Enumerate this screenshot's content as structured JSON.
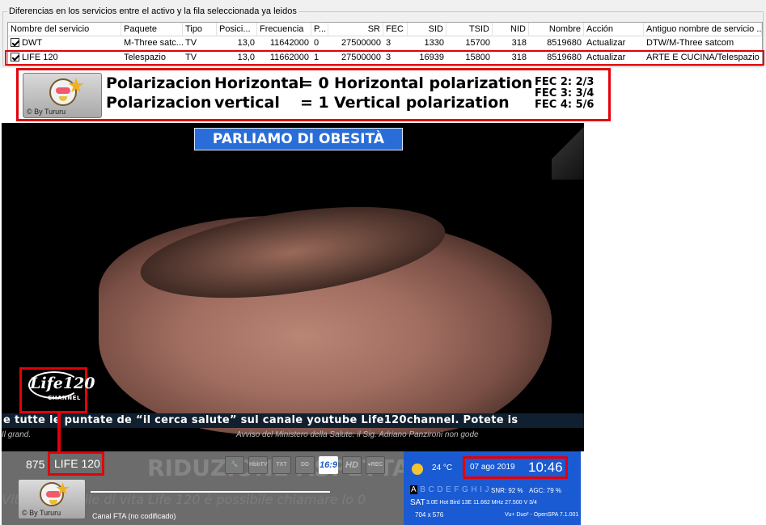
{
  "groupbox": {
    "title": "Diferencias en los servicios entre el activo y la fila seleccionada ya leidos"
  },
  "table": {
    "headers": [
      "Nombre del servicio",
      "Paquete",
      "Tipo",
      "Posici...",
      "Frecuencia",
      "P...",
      "SR",
      "FEC",
      "SID",
      "TSID",
      "NID",
      "Nombre",
      "Acción",
      "Antiguo nombre de servicio ..."
    ],
    "rows": [
      {
        "checked": true,
        "servicio": "DWT",
        "paquete": "M-Three satc...",
        "tipo": "TV",
        "posicion": "13,0",
        "frecuencia": "11642000",
        "p": "0",
        "sr": "27500000",
        "fec": "3",
        "sid": "1330",
        "tsid": "15700",
        "nid": "318",
        "nombre": "8519680",
        "accion": "Actualizar",
        "antiguo": "DTW/M-Three satcom"
      },
      {
        "checked": true,
        "servicio": "LIFE 120",
        "paquete": "Telespazio",
        "tipo": "TV",
        "posicion": "13,0",
        "frecuencia": "11662000",
        "p": "1",
        "sr": "27500000",
        "fec": "3",
        "sid": "16939",
        "tsid": "15800",
        "nid": "318",
        "nombre": "8519680",
        "accion": "Actualizar",
        "antiguo": "ARTE E CUCINA/Telespazio"
      }
    ]
  },
  "legend": {
    "logo_caption": "© By Tururu",
    "line1": {
      "a": "Polarizacion",
      "b": "Horizontal",
      "c": "= 0",
      "d": "Horizontal polarization"
    },
    "line2": {
      "a": "Polarizacion",
      "b": "vertical",
      "c": "= 1",
      "d": "Vertical polarization"
    },
    "fec": [
      "FEC 2: 2/3",
      "FEC 3: 3/4",
      "FEC 4: 5/6"
    ]
  },
  "video": {
    "title_banner": "PARLIAMO DI OBESITÀ",
    "ticker": "e tutte le puntate de “il cerca salute” sul canale youtube Life120channel. Potete is",
    "subticker_left": "Il grand.",
    "subticker_right": "Avviso del Ministero della Salute: il Sig. Adriano Panzironi non gode",
    "channel_logo_line1": "Life120",
    "channel_logo_line2": "CHANNEL"
  },
  "infobar": {
    "bg_text": "RIDUZIONE ASPETTATIVA",
    "bg_text2": "Vita sotto ... ile di vita Life 120 è possibile chiamare lo 0",
    "channel_number": "875",
    "channel_name": "LIFE 120",
    "icons": [
      {
        "name": "wrench-icon",
        "label": "🔧",
        "on": false
      },
      {
        "name": "hbbtv-icon",
        "label": "HbbTV",
        "on": false
      },
      {
        "name": "teletext-icon",
        "label": "TXT",
        "on": false
      },
      {
        "name": "dolby-icon",
        "label": "DD",
        "on": false
      },
      {
        "name": "aspect-16-9-icon",
        "label": "16:9",
        "on": true
      },
      {
        "name": "hd-icon",
        "label": "HD",
        "on": false
      },
      {
        "name": "rec-icon",
        "label": "●REC",
        "on": false
      }
    ],
    "logo_caption": "© By Tururu",
    "canal_text": "Canal FTA (no codificado)",
    "temperature": "24 °C",
    "date": "07 ago 2019",
    "time": "10:46",
    "letters_active": "A",
    "letters_rest": "B C D E F G H I J",
    "snr": "SNR: 92 %",
    "agc": "AGC: 79 %",
    "sat_label": "SAT",
    "sat_info": "3.0E Hot Bird 13E 11.662 MHz 27.500 V 3/4",
    "resolution": "704 x 576",
    "box_info": "Vu+ Duo² - OpenSPA 7.1.001"
  },
  "colors": {
    "highlight_red": "#e3000b",
    "info_blue": "#1a5bd3",
    "banner_blue": "#2a6dd8"
  }
}
